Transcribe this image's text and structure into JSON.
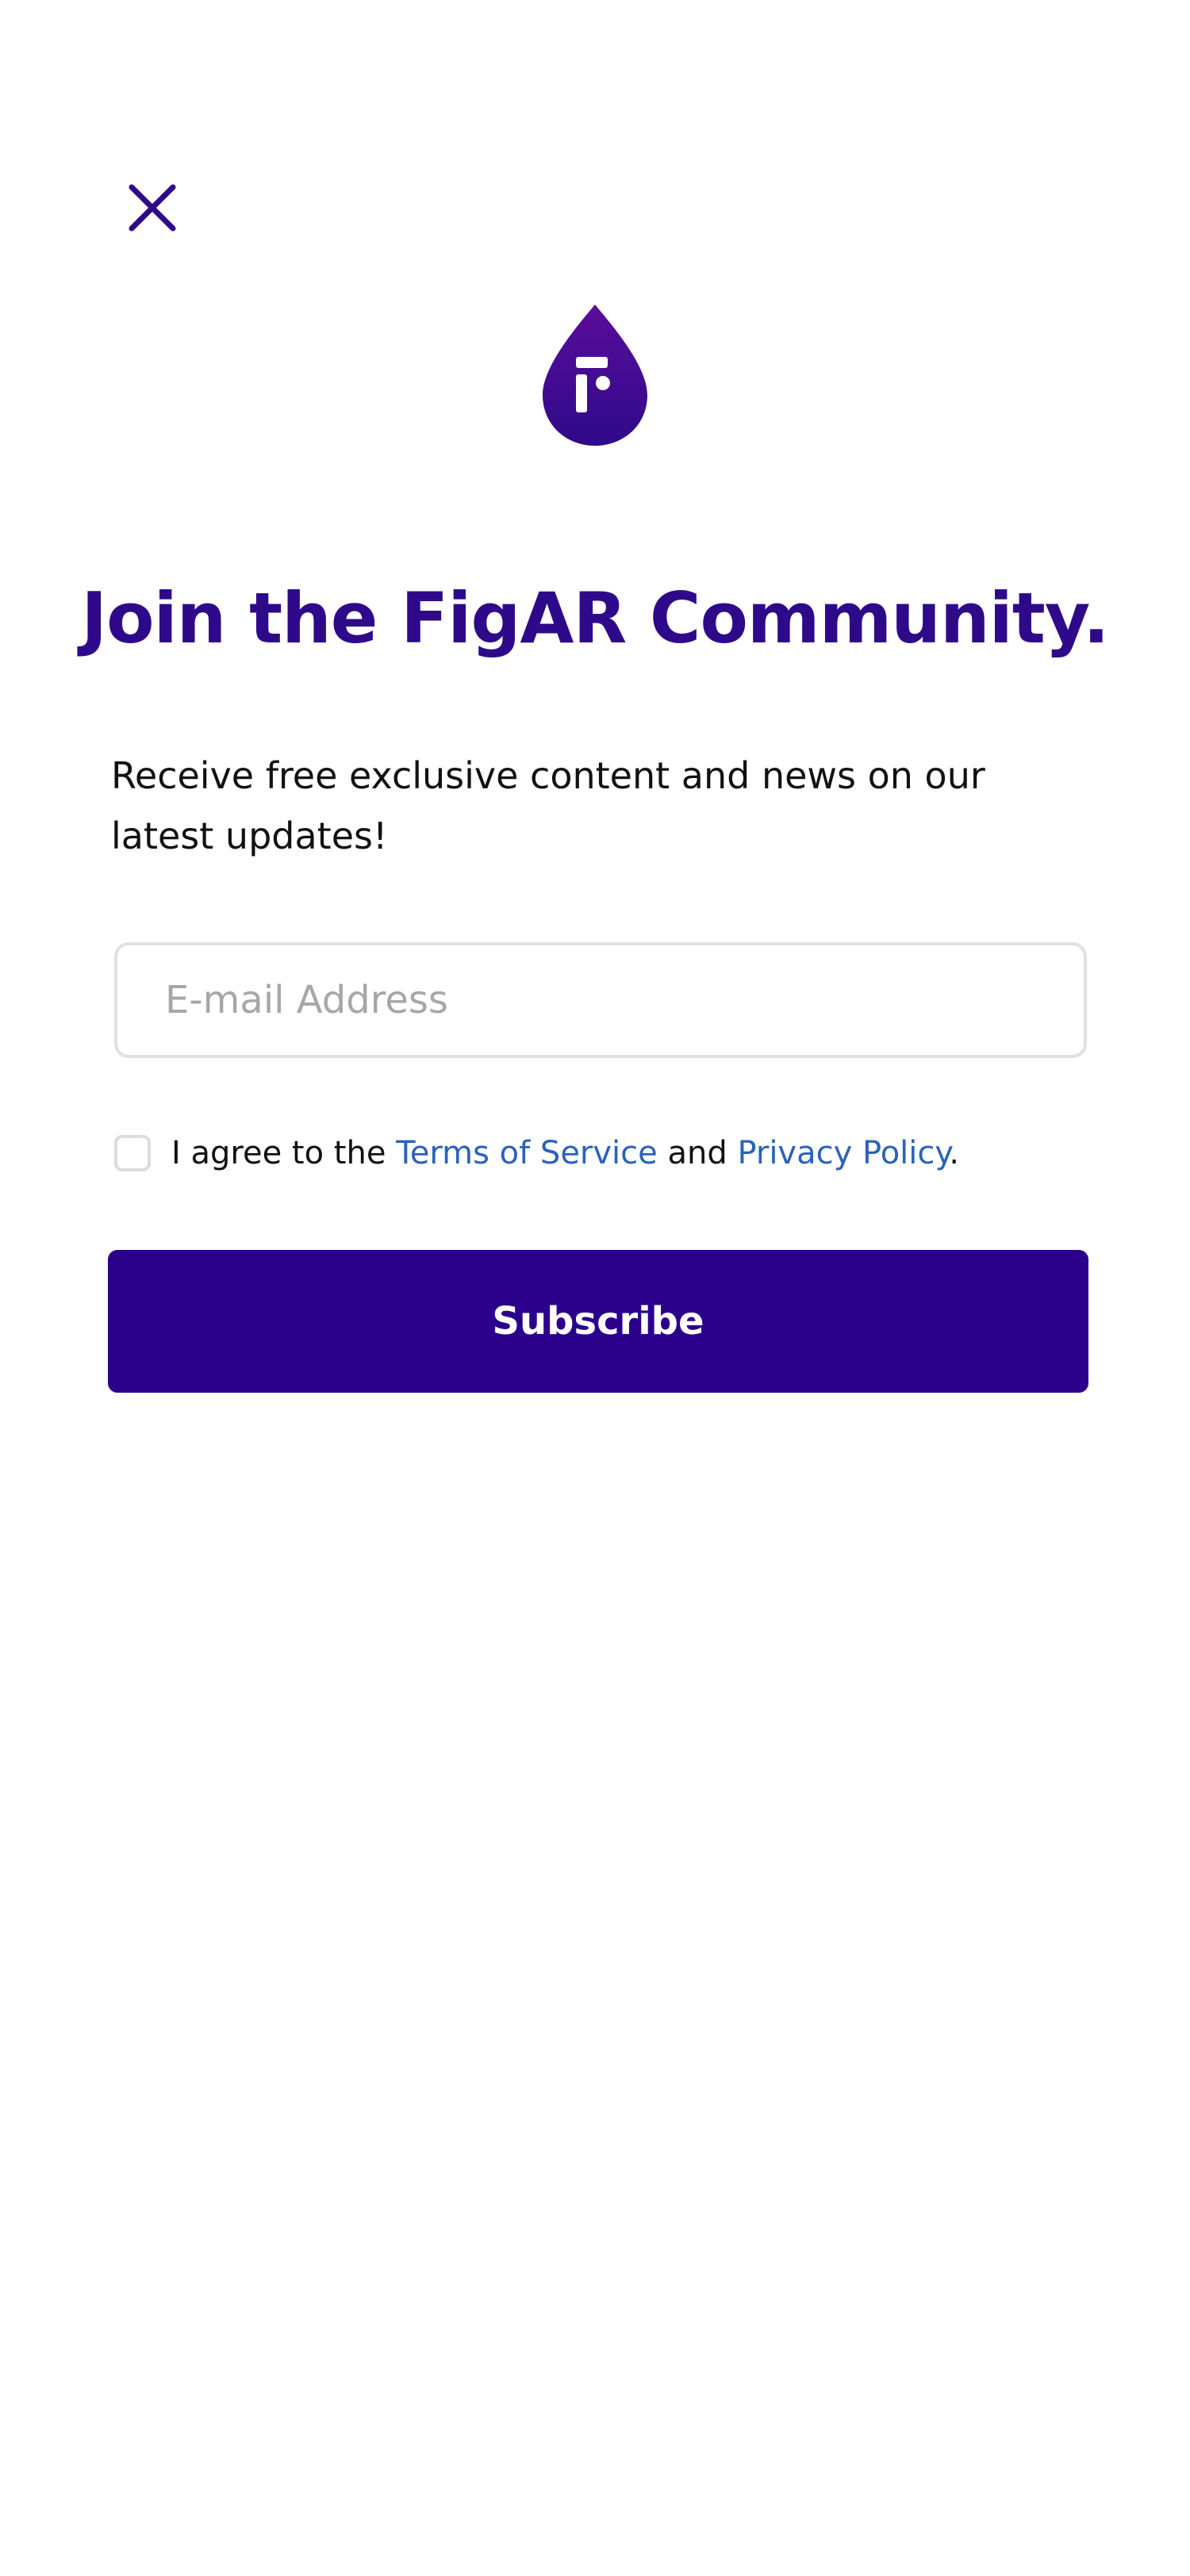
{
  "colors": {
    "brand": "#2e0a8a",
    "button_bg": "#2b008b",
    "link": "#2a63b8",
    "input_border": "#e1e1e1",
    "placeholder": "#a7a7a7"
  },
  "header": {
    "close_icon": "close-icon",
    "logo_icon": "figar-drop-logo"
  },
  "main": {
    "title": "Join the FigAR Community.",
    "description": "Receive free exclusive content and news on our latest updates!",
    "email": {
      "placeholder": "E-mail Address",
      "value": ""
    },
    "consent": {
      "checked": false,
      "prefix": "I agree to the ",
      "terms_link": "Terms of Service",
      "middle": " and ",
      "privacy_link": "Privacy Policy",
      "suffix": "."
    },
    "subscribe_label": "Subscribe"
  }
}
